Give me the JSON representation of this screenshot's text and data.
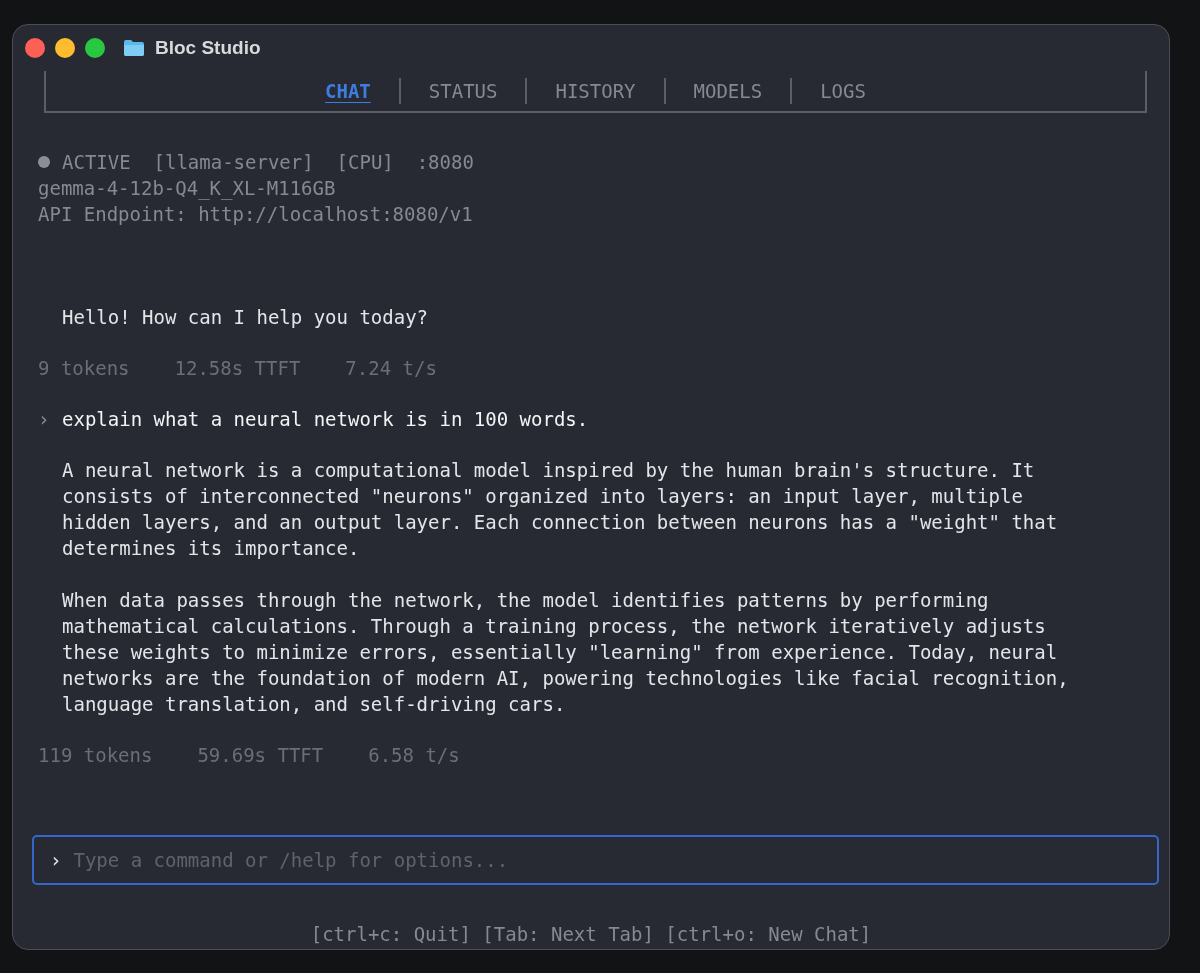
{
  "window": {
    "title": "Bloc Studio"
  },
  "tabs": [
    {
      "label": "CHAT",
      "selected": true
    },
    {
      "label": "STATUS",
      "selected": false
    },
    {
      "label": "HISTORY",
      "selected": false
    },
    {
      "label": "MODELS",
      "selected": false
    },
    {
      "label": "LOGS",
      "selected": false
    }
  ],
  "server_status": {
    "state": "ACTIVE",
    "backend": "[llama-server]",
    "device": "[CPU]",
    "port": ":8080",
    "model": "gemma-4-12b-Q4_K_XL-M116GB",
    "endpoint": "API Endpoint: http://localhost:8080/v1"
  },
  "messages": [
    {
      "kind": "assistant",
      "paragraphs": [
        [
          "Hello! How can I help you today?"
        ]
      ]
    },
    {
      "kind": "stats",
      "items": [
        "9 tokens",
        "12.58s TTFT",
        "7.24 t/s"
      ]
    },
    {
      "kind": "user",
      "prompt_marker": "›",
      "text": "explain what a neural network is in 100 words."
    },
    {
      "kind": "assistant",
      "paragraphs": [
        [
          "A neural network is a computational model inspired by the human brain's structure. It",
          "consists of interconnected \"neurons\" organized into layers: an input layer, multiple",
          "hidden layers, and an output layer. Each connection between neurons has a \"weight\" that",
          "determines its importance."
        ],
        [
          "When data passes through the network, the model identifies patterns by performing",
          "mathematical calculations. Through a training process, the network iteratively adjusts",
          "these weights to minimize errors, essentially \"learning\" from experience. Today, neural",
          "networks are the foundation of modern AI, powering technologies like facial recognition,",
          "language translation, and self-driving cars."
        ]
      ]
    },
    {
      "kind": "stats",
      "items": [
        "119 tokens",
        "59.69s TTFT",
        "6.58 t/s"
      ]
    }
  ],
  "command_input": {
    "prompt_marker": "›",
    "placeholder": "Type a command or /help for options..."
  },
  "footer": "[ctrl+c: Quit] [Tab: Next Tab] [ctrl+o: New Chat]"
}
